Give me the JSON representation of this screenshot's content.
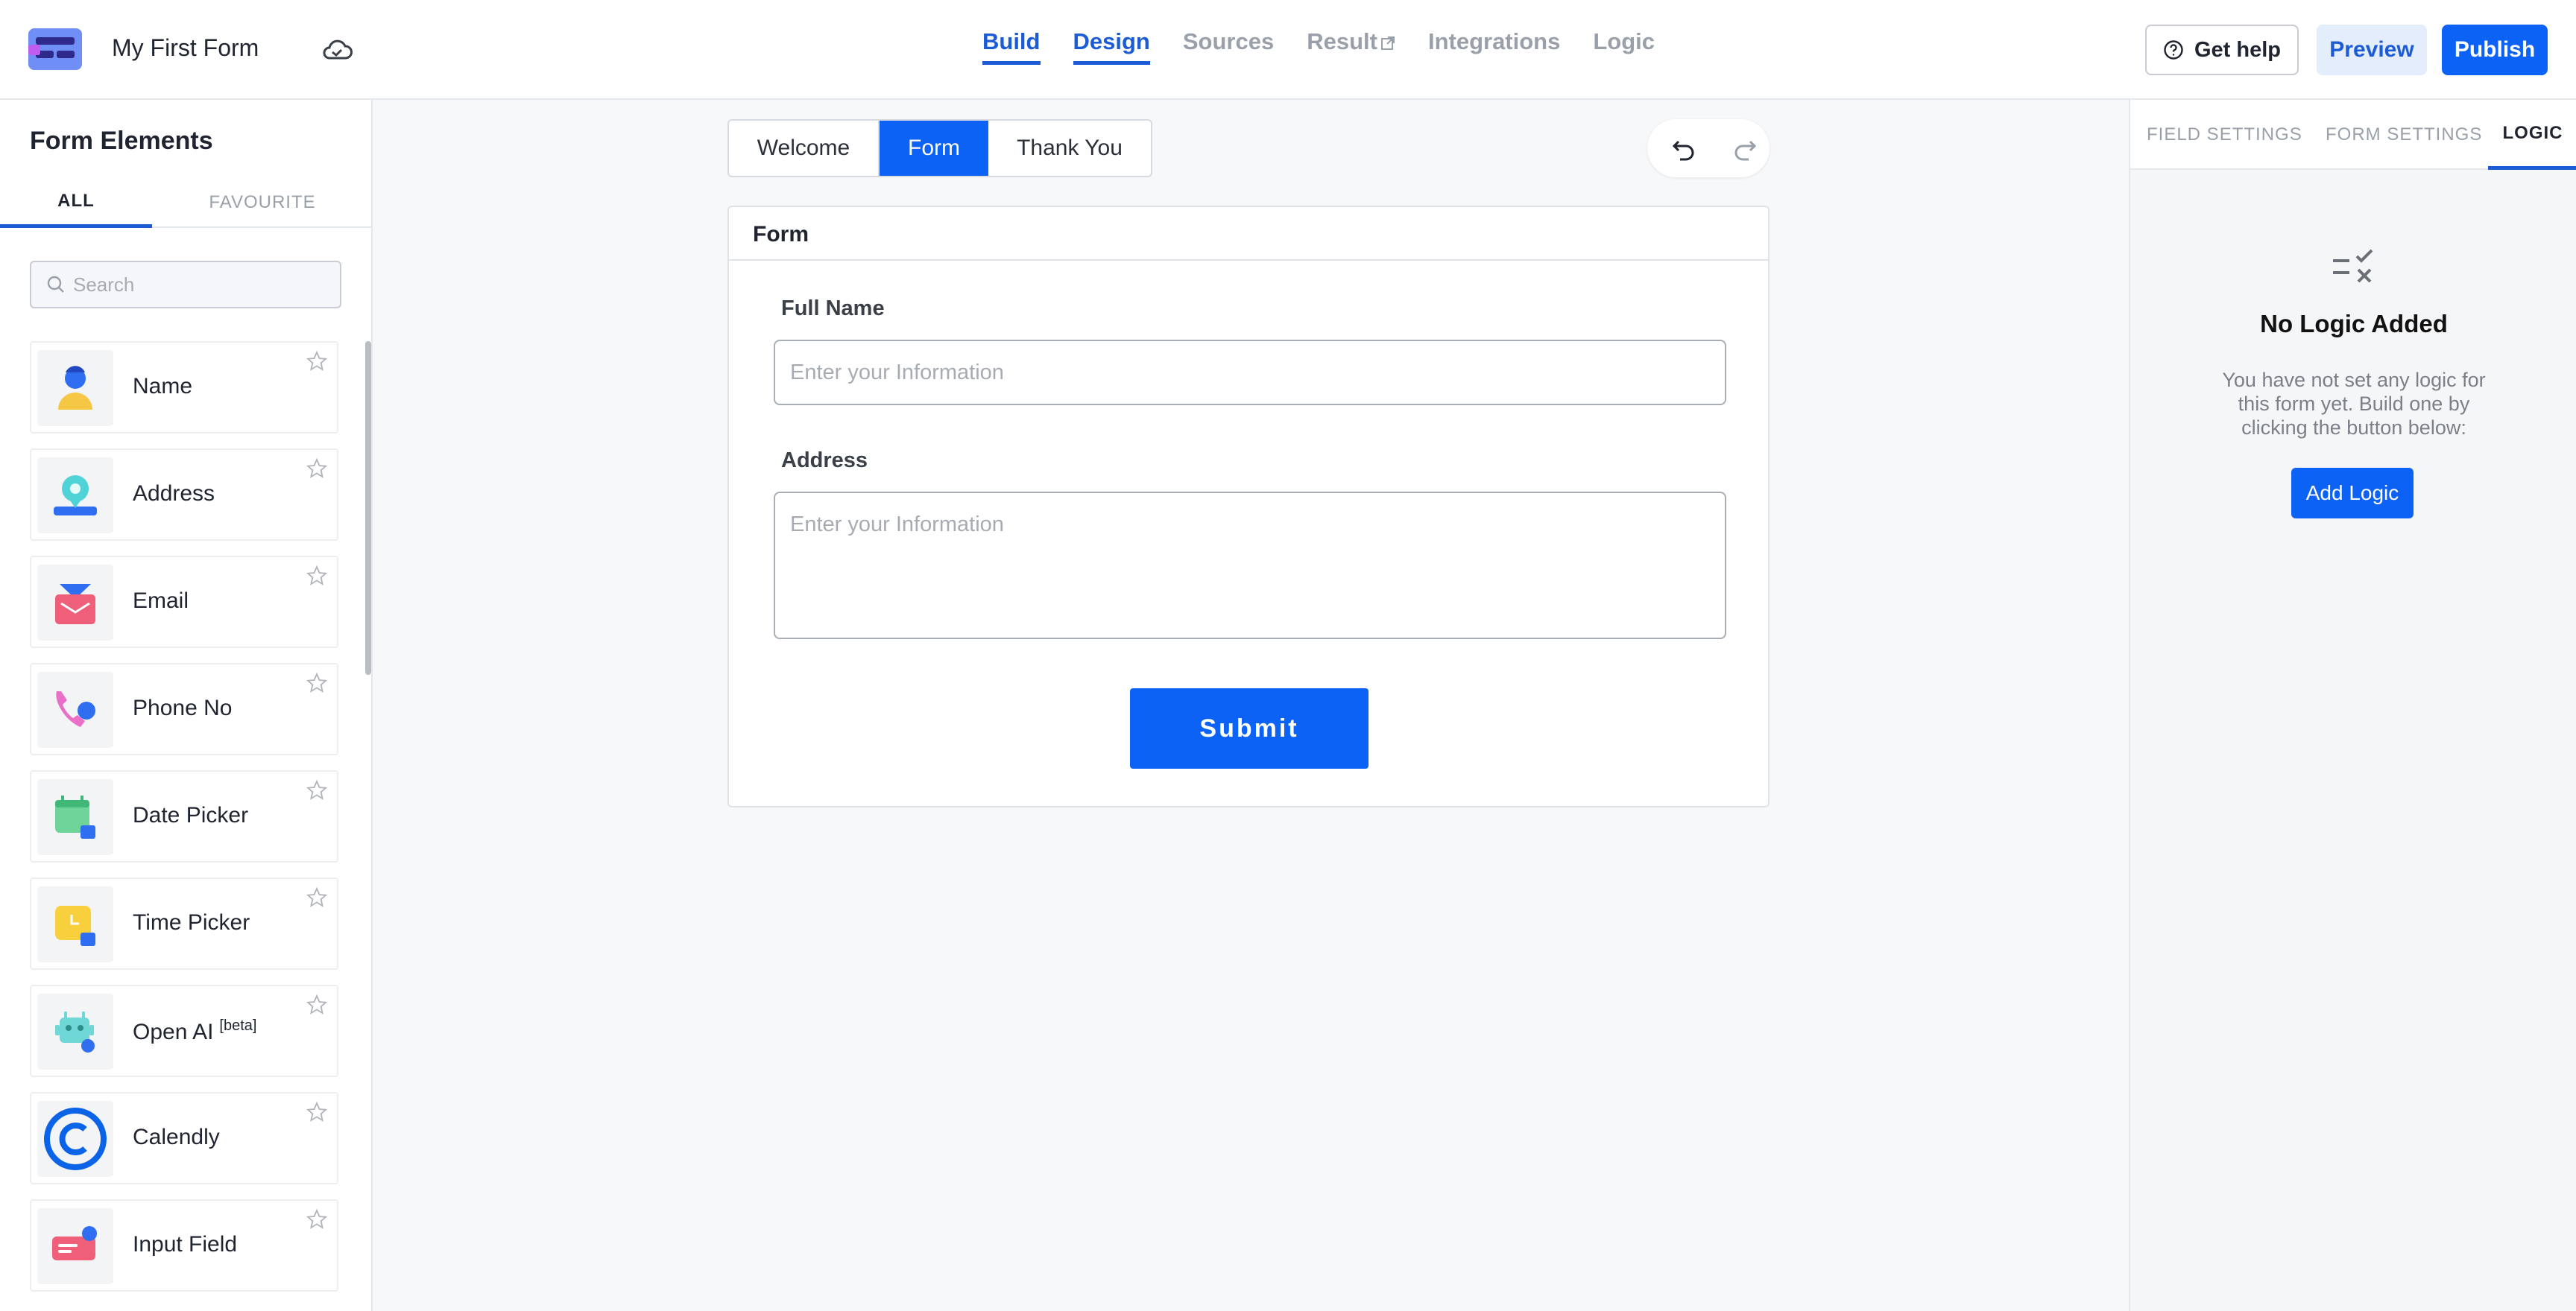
{
  "header": {
    "form_title": "My First Form",
    "nav": [
      {
        "label": "Build",
        "active": true
      },
      {
        "label": "Design",
        "active": true
      },
      {
        "label": "Sources",
        "active": false
      },
      {
        "label": "Result",
        "active": false,
        "external": true
      },
      {
        "label": "Integrations",
        "active": false
      },
      {
        "label": "Logic",
        "active": false
      }
    ],
    "help_label": "Get help",
    "preview_label": "Preview",
    "publish_label": "Publish"
  },
  "sidebar": {
    "title": "Form Elements",
    "tabs": [
      {
        "label": "ALL",
        "active": true
      },
      {
        "label": "FAVOURITE",
        "active": false
      }
    ],
    "search_placeholder": "Search",
    "elements": [
      {
        "label": "Name",
        "icon": "person-icon"
      },
      {
        "label": "Address",
        "icon": "location-pin-icon"
      },
      {
        "label": "Email",
        "icon": "envelope-icon"
      },
      {
        "label": "Phone No",
        "icon": "phone-icon"
      },
      {
        "label": "Date Picker",
        "icon": "calendar-icon"
      },
      {
        "label": "Time Picker",
        "icon": "clock-icon"
      },
      {
        "label": "Open AI",
        "badge": "[beta]",
        "icon": "robot-icon"
      },
      {
        "label": "Calendly",
        "icon": "calendly-logo-icon"
      },
      {
        "label": "Input Field",
        "icon": "input-field-icon"
      }
    ]
  },
  "canvas": {
    "segments": [
      {
        "label": "Welcome",
        "active": false
      },
      {
        "label": "Form",
        "active": true
      },
      {
        "label": "Thank You",
        "active": false
      }
    ],
    "form": {
      "header": "Form",
      "fields": [
        {
          "label": "Full Name",
          "placeholder": "Enter your Information",
          "type": "text"
        },
        {
          "label": "Address",
          "placeholder": "Enter your Information",
          "type": "textarea"
        }
      ],
      "submit_label": "Submit"
    }
  },
  "right_panel": {
    "tabs": [
      {
        "label": "FIELD SETTINGS",
        "active": false
      },
      {
        "label": "FORM SETTINGS",
        "active": false
      },
      {
        "label": "LOGIC",
        "active": true
      }
    ],
    "empty_title": "No Logic Added",
    "empty_desc": "You have not set any logic for this form yet. Build one by clicking the button below:",
    "add_button": "Add Logic"
  },
  "colors": {
    "accent": "#0c62f5",
    "nav_active": "#1c5bd6"
  }
}
